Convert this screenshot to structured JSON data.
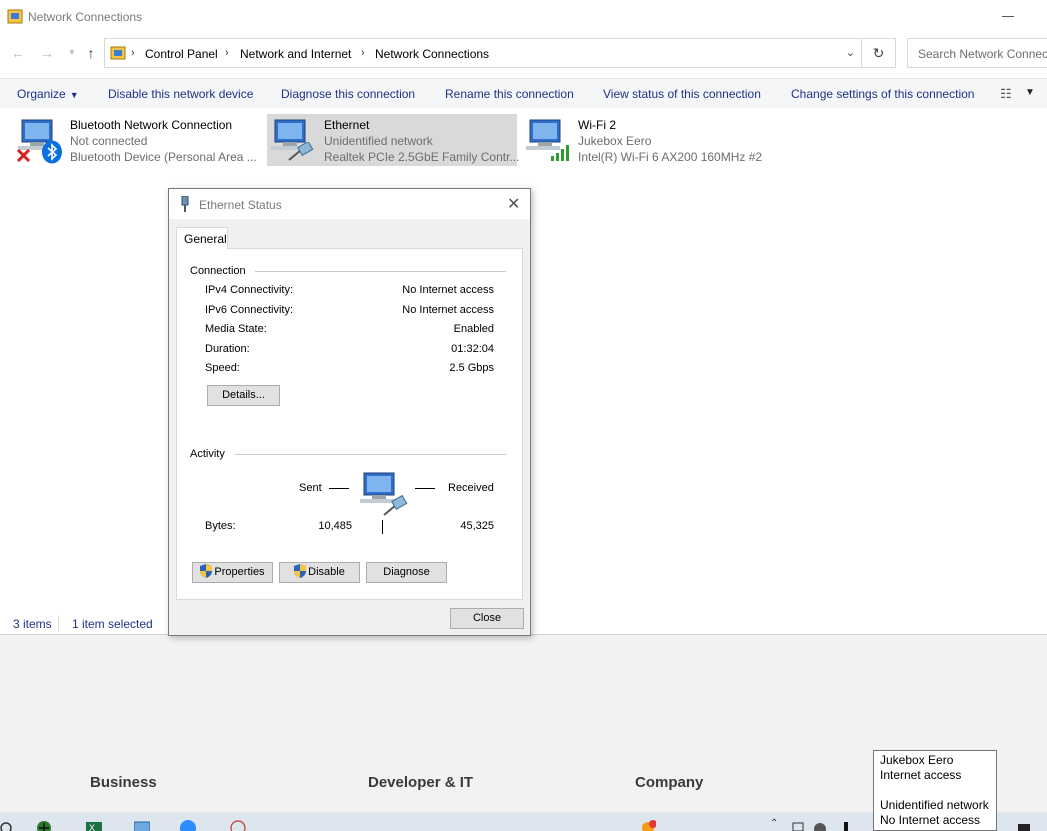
{
  "window": {
    "title": "Network Connections"
  },
  "address": {
    "crumbs": [
      "Control Panel",
      "Network and Internet",
      "Network Connections"
    ],
    "search_placeholder": "Search Network Connections"
  },
  "toolbar": {
    "organize": "Organize",
    "disable": "Disable this network device",
    "diagnose": "Diagnose this connection",
    "rename": "Rename this connection",
    "view_status": "View status of this connection",
    "change_settings": "Change settings of this connection"
  },
  "connections": [
    {
      "name": "Bluetooth Network Connection",
      "status": "Not connected",
      "device": "Bluetooth Device (Personal Area ..."
    },
    {
      "name": "Ethernet",
      "status": "Unidentified network",
      "device": "Realtek PCIe 2.5GbE Family Contr..."
    },
    {
      "name": "Wi-Fi 2",
      "status": "Jukebox Eero",
      "device": "Intel(R) Wi-Fi 6 AX200 160MHz #2"
    }
  ],
  "statusbar": {
    "items": "3 items",
    "selected": "1 item selected"
  },
  "dialog": {
    "title": "Ethernet Status",
    "tab": "General",
    "connection_label": "Connection",
    "rows": [
      {
        "k": "IPv4 Connectivity:",
        "v": "No Internet access"
      },
      {
        "k": "IPv6 Connectivity:",
        "v": "No Internet access"
      },
      {
        "k": "Media State:",
        "v": "Enabled"
      },
      {
        "k": "Duration:",
        "v": "01:32:04"
      },
      {
        "k": "Speed:",
        "v": "2.5 Gbps"
      }
    ],
    "details": "Details...",
    "activity_label": "Activity",
    "sent": "Sent",
    "received": "Received",
    "bytes_label": "Bytes:",
    "bytes_sent": "10,485",
    "bytes_received": "45,325",
    "properties": "Properties",
    "disable": "Disable",
    "diagnose": "Diagnose",
    "close": "Close"
  },
  "footer": {
    "business": "Business",
    "developer": "Developer & IT",
    "company": "Company"
  },
  "tooltip": {
    "wifi_name": "Jukebox Eero",
    "wifi_status": "Internet access",
    "eth_name": "Unidentified network",
    "eth_status": "No Internet access"
  },
  "colors": {
    "link": "#1e3287",
    "selected_item": "#d9d9d9",
    "taskbar": "#dde6ef"
  }
}
